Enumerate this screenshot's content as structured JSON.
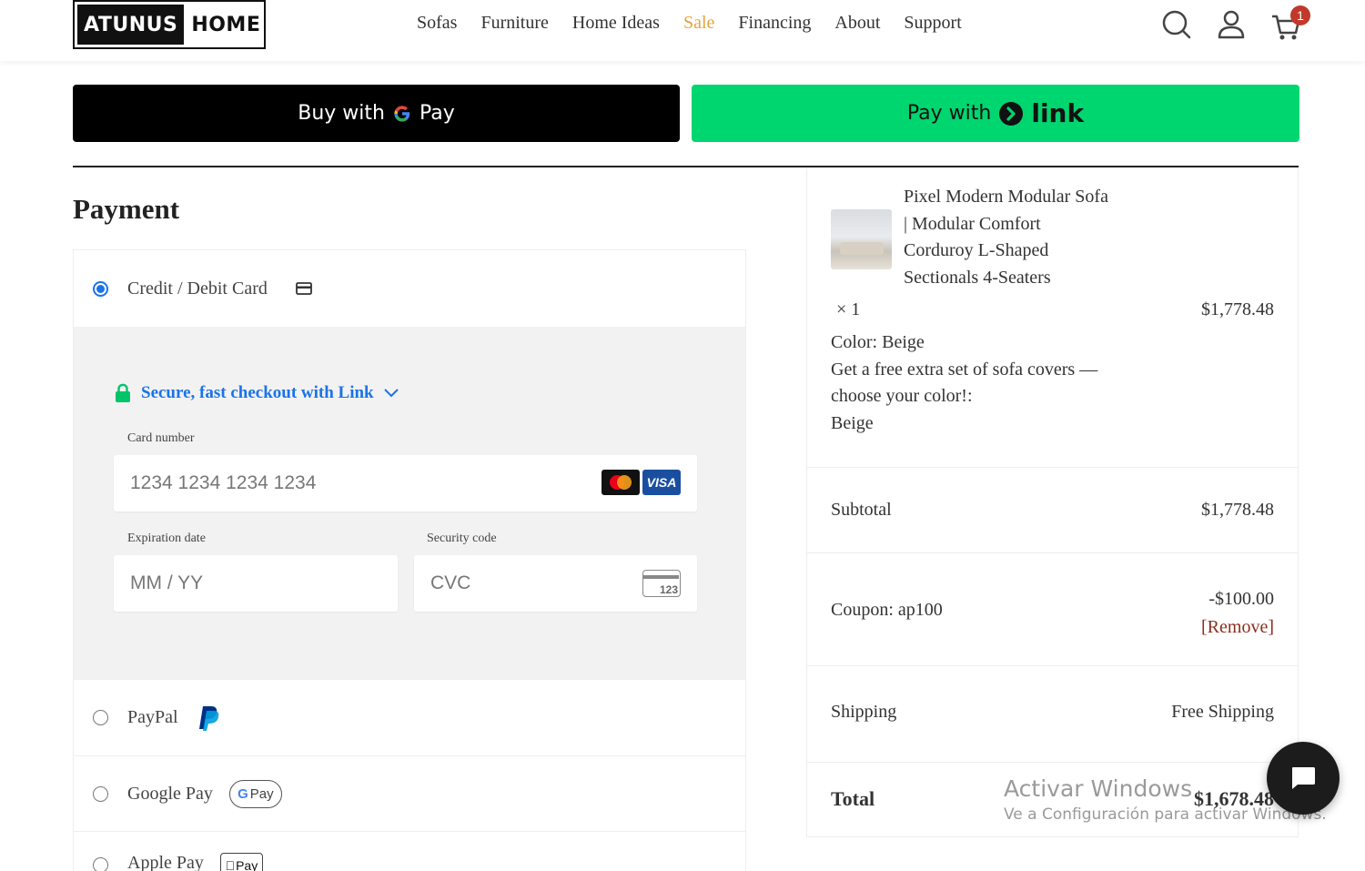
{
  "brand": {
    "logo_part1": "ATUNUS",
    "logo_part2": "HOME"
  },
  "nav": {
    "items": [
      "Sofas",
      "Furniture",
      "Home Ideas",
      "Sale",
      "Financing",
      "About",
      "Support"
    ],
    "highlight_color": "#e8a33d"
  },
  "header_icons": [
    "search-icon",
    "account-icon",
    "cart-icon"
  ],
  "cart": {
    "count": "1"
  },
  "express": {
    "gpay_prefix": "Buy with",
    "gpay_word": "Pay",
    "link_prefix": "Pay with",
    "link_word": "link",
    "link_color": "#00d66f"
  },
  "payment": {
    "title": "Payment",
    "options": [
      {
        "label": "Credit / Debit Card",
        "selected": true
      },
      {
        "label": "PayPal",
        "selected": false
      },
      {
        "label": "Google Pay",
        "selected": false
      },
      {
        "label": "Apple Pay",
        "selected": false
      }
    ],
    "card_form": {
      "link_secure": "Secure, fast checkout with Link",
      "card_number_label": "Card number",
      "card_number_placeholder": "1234 1234 1234 1234",
      "expiry_label": "Expiration date",
      "expiry_placeholder": "MM / YY",
      "cvc_label": "Security code",
      "cvc_placeholder": "CVC",
      "cvc_icon_text": "123",
      "brands": [
        "Mastercard",
        "VISA"
      ]
    },
    "gpay_badge": "Pay",
    "apple_badge": "Pay"
  },
  "summary": {
    "product_name": "Pixel Modern Modular Sofa | Modular Comfort Corduroy L-Shaped Sectionals 4-Seaters",
    "quantity": "× 1",
    "line_price": "$1,778.48",
    "color_line": "Color: Beige",
    "option_line": "Get a free extra set of sofa covers —choose your color!:",
    "option_value": "Beige",
    "subtotal_label": "Subtotal",
    "subtotal_value": "$1,778.48",
    "coupon_label": "Coupon: ap100",
    "coupon_value": "-$100.00",
    "coupon_remove": "[Remove]",
    "shipping_label": "Shipping",
    "shipping_value": "Free Shipping",
    "total_label": "Total",
    "total_value": "$1,678.48"
  },
  "watermark": {
    "line1": "Activar Windows",
    "line2": "Ve a Configuración para activar Windows."
  }
}
